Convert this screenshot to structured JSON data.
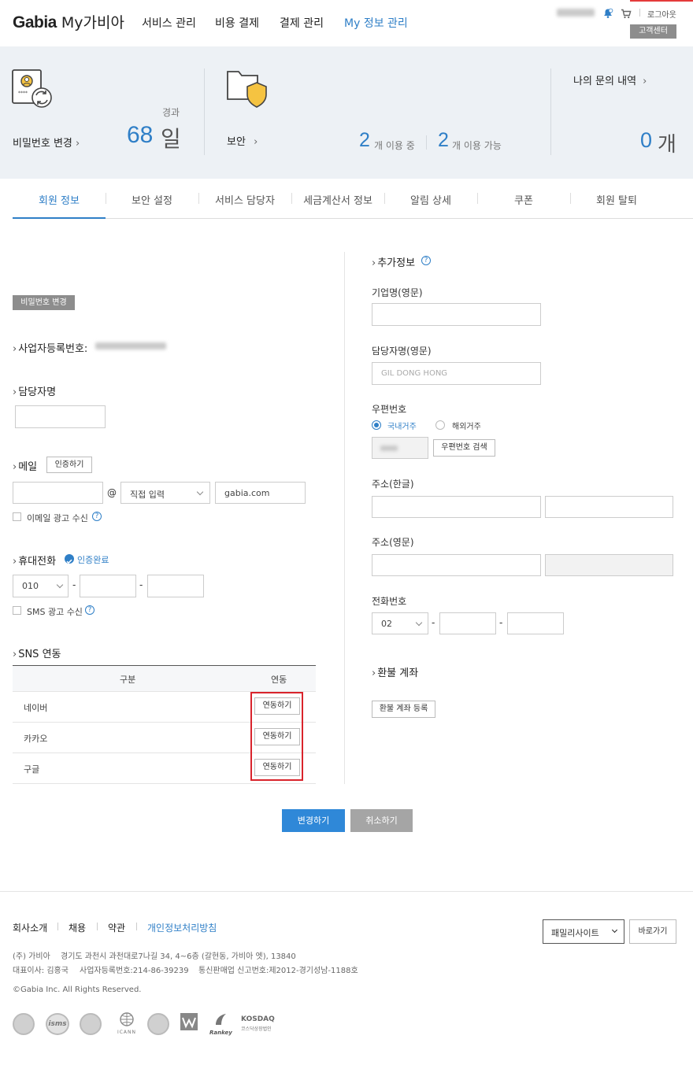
{
  "header": {
    "logo_brand": "Gabia",
    "logo_product": "My가비아",
    "nav": [
      "서비스 관리",
      "비용 결제",
      "결제 관리",
      "My 정보 관리"
    ],
    "logout": "로그아웃",
    "customer_center": "고객센터",
    "accent": "#2f7fc7"
  },
  "stats": {
    "password": {
      "label": "비밀번호 변경",
      "elapsed_label": "경과",
      "days": "68",
      "unit": "일"
    },
    "security": {
      "label": "보안",
      "in_use": "2",
      "in_use_unit": "개 이용 중",
      "available": "2",
      "available_unit": "개 이용 가능"
    },
    "inquiry": {
      "label": "나의 문의 내역",
      "count": "0",
      "unit": "개"
    }
  },
  "tabs": [
    "회원 정보",
    "보안 설정",
    "서비스 담당자",
    "세금계산서 정보",
    "알림 상세",
    "쿠폰",
    "회원 탈퇴"
  ],
  "left": {
    "pw_btn": "비밀번호 변경",
    "bizno_label": "사업자등록번호:",
    "manager_label": "담당자명",
    "mail_label": "메일",
    "verify_btn": "인증하기",
    "at": "@",
    "domain_select": "직접 입력",
    "domain_value": "gabia.com",
    "email_ad": "이메일 광고 수신",
    "phone_label": "휴대전화",
    "verified": "인증완료",
    "phone_prefix": "010",
    "dash": "-",
    "sms_ad": "SMS 광고 수신",
    "sns_label": "SNS 연동",
    "sns_headers": [
      "구분",
      "연동"
    ],
    "sns_rows": [
      {
        "name": "네이버",
        "action": "연동하기"
      },
      {
        "name": "카카오",
        "action": "연동하기"
      },
      {
        "name": "구글",
        "action": "연동하기"
      }
    ]
  },
  "right": {
    "extra_label": "추가정보",
    "company_en": "기업명(영문)",
    "manager_en": "담당자명(영문)",
    "manager_en_ph": "GIL DONG HONG",
    "zip_label": "우편번호",
    "domestic": "국내거주",
    "overseas": "해외거주",
    "zip_search": "우편번호 검색",
    "addr_ko": "주소(한글)",
    "addr_en": "주소(영문)",
    "tel_label": "전화번호",
    "tel_prefix": "02",
    "refund_label": "환불 계좌",
    "refund_btn": "환불 계좌 등록"
  },
  "actions": {
    "save": "변경하기",
    "cancel": "취소하기"
  },
  "footer": {
    "links": [
      "회사소개",
      "채용",
      "약관",
      "개인정보처리방침"
    ],
    "family_site": "패밀리사이트",
    "go": "바로가기",
    "company": "(주) 가비아",
    "address": "경기도 과천시 과천대로7나길 34, 4~6층 (갈현동, 가비아 엣), 13840",
    "ceo": "대표이사: 김홍국",
    "bizno": "사업자등록번호:214-86-39239",
    "ecommerce": "통신판매업 신고번호:제2012-경기성남-1188호",
    "copyright": "©Gabia Inc. All Rights Reserved.",
    "logo_isms": "isms",
    "logo_icann": "ICANN",
    "logo_rankey": "Rankey",
    "logo_kosdaq": "KOSDAQ",
    "logo_kosdaq_sub": "코스닥상장법인"
  }
}
